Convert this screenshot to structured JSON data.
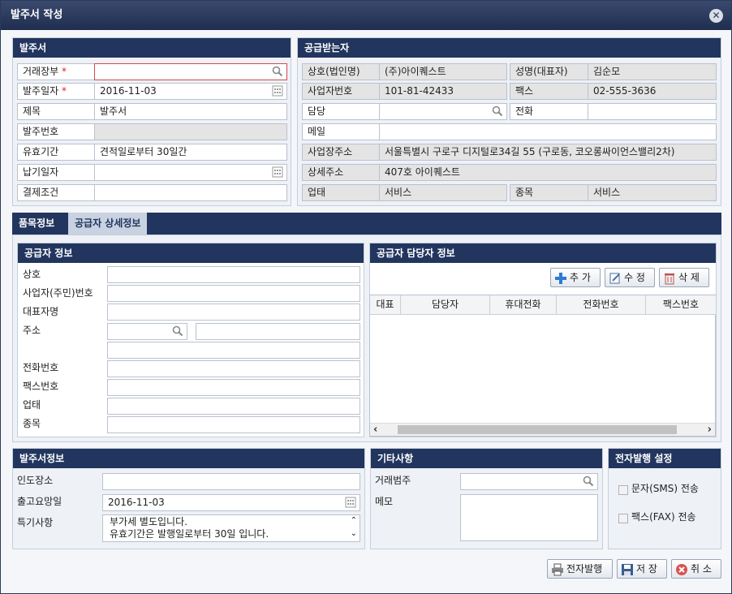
{
  "window": {
    "title": "발주서 작성"
  },
  "order": {
    "header": "발주서",
    "rows": [
      {
        "label": "거래장부",
        "required": "*",
        "value": ""
      },
      {
        "label": "발주일자",
        "required": "*",
        "value": "2016-11-03"
      },
      {
        "label": "제목",
        "value": "발주서"
      },
      {
        "label": "발주번호",
        "value": ""
      },
      {
        "label": "유효기간",
        "value": "견적일로부터 30일간"
      },
      {
        "label": "납기일자",
        "value": ""
      },
      {
        "label": "결제조건",
        "value": ""
      }
    ]
  },
  "receiver": {
    "header": "공급받는자",
    "company_label": "상호(법인명)",
    "company": "(주)아이퀘스트",
    "ceo_label": "성명(대표자)",
    "ceo": "김순모",
    "bizno_label": "사업자번호",
    "bizno": "101-81-42433",
    "fax_label": "팩스",
    "fax": "02-555-3636",
    "manager_label": "담당",
    "manager": "",
    "phone_label": "전화",
    "phone": "",
    "email_label": "메일",
    "email": "",
    "address_label": "사업장주소",
    "address": "서울특별시 구로구 디지털로34길 55 (구로동, 코오롱싸이언스밸리2차)",
    "detail_label": "상세주소",
    "detail": "407호 아이퀘스트",
    "biztype_label": "업태",
    "biztype": "서비스",
    "bizitem_label": "종목",
    "bizitem": "서비스"
  },
  "tabs": {
    "items_tab": "품목정보",
    "supplier_tab": "공급자 상세정보"
  },
  "supplier": {
    "header": "공급자 정보",
    "labels": {
      "company": "상호",
      "regno": "사업자(주민)번호",
      "ceo": "대표자명",
      "address": "주소",
      "phone": "전화번호",
      "fax": "팩스번호",
      "biztype": "업태",
      "bizitem": "종목"
    }
  },
  "contacts": {
    "header": "공급자 담당자 정보",
    "add": "추 가",
    "edit": "수 정",
    "delete": "삭 제",
    "columns": [
      "대표",
      "담당자",
      "휴대전화",
      "전화번호",
      "팩스번호"
    ]
  },
  "orderinfo": {
    "header": "발주서정보",
    "place_label": "인도장소",
    "place": "",
    "date_label": "출고요망일",
    "date": "2016-11-03",
    "note_label": "특기사항",
    "note1": "부가세 별도입니다.",
    "note2": "유효기간은 발행일로부터 30일 입니다."
  },
  "etc": {
    "header": "기타사항",
    "category_label": "거래범주",
    "memo_label": "메모"
  },
  "epub": {
    "header": "전자발행 설정",
    "sms": "문자(SMS) 전송",
    "fax": "팩스(FAX) 전송"
  },
  "footer": {
    "issue": "전자발행",
    "save": "저 장",
    "cancel": "취 소"
  },
  "colors": {
    "header": "#22355e",
    "accent": "#2b7bd6",
    "required": "#dd2222"
  }
}
